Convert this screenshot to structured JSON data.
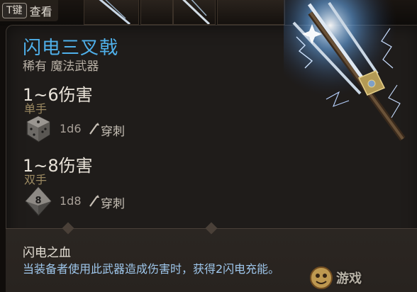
{
  "hotkey": {
    "key": "T键",
    "label": "查看"
  },
  "item": {
    "name": "闪电三叉戟",
    "rarity_type": "稀有 魔法武器",
    "name_color": "#4fb0ea"
  },
  "attacks": [
    {
      "damage": "1~6伤害",
      "hand": "单手",
      "die_icon": "d6-dice-icon",
      "die": "1d6",
      "damage_type_icon": "pierce-icon",
      "damage_type": "穿刺"
    },
    {
      "damage": "1~8伤害",
      "hand": "双手",
      "die_icon": "d8-dice-icon",
      "die": "1d8",
      "die_face": "8",
      "damage_type_icon": "pierce-icon",
      "damage_type": "穿刺"
    }
  ],
  "passive": {
    "title": "闪电之血",
    "description": "当装备者使用此武器造成伤害时，获得2闪电充能。",
    "description_color": "#9fc7ec"
  },
  "watermark": {
    "text": "游戏"
  }
}
